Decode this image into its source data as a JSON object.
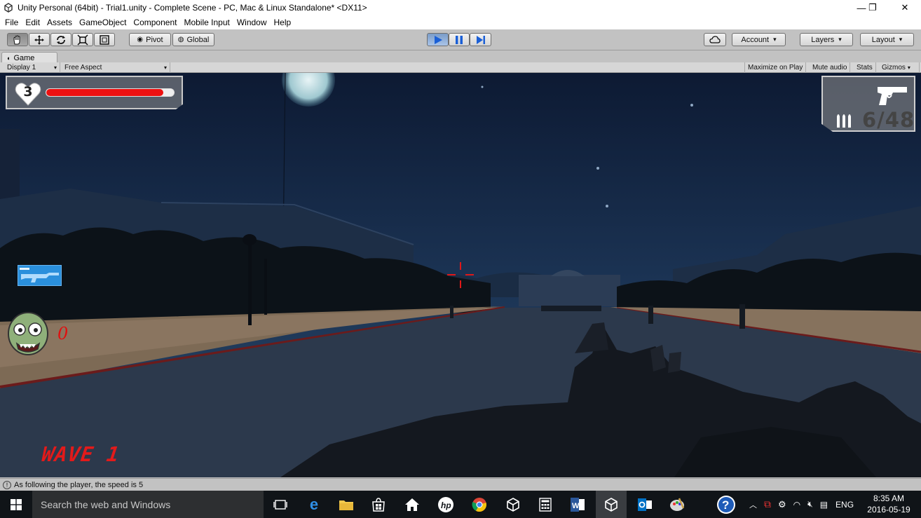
{
  "window": {
    "title": "Unity Personal (64bit) - Trial1.unity - Complete Scene - PC, Mac & Linux Standalone* <DX11>",
    "minimize": "—",
    "maximize": "❐",
    "close": "✕"
  },
  "menu": [
    "File",
    "Edit",
    "Assets",
    "GameObject",
    "Component",
    "Mobile Input",
    "Window",
    "Help"
  ],
  "toolbar": {
    "pivot_label": "Pivot",
    "global_label": "Global",
    "account_label": "Account",
    "layers_label": "Layers",
    "layout_label": "Layout",
    "play_active": true
  },
  "game_tab": {
    "label": "Game",
    "display": "Display 1",
    "aspect": "Free Aspect",
    "maximize_on_play": "Maximize on Play",
    "mute_audio": "Mute audio",
    "stats": "Stats",
    "gizmos": "Gizmos"
  },
  "hud": {
    "lives": "3",
    "health_fraction": 0.92,
    "ammo": "6/48",
    "kills": "0",
    "wave": "WAVE 1",
    "weapon_icon": "rifle-icon",
    "colors": {
      "health": "#ee1111",
      "crosshair": "#e01818",
      "wave": "#e31a1a"
    }
  },
  "status": {
    "message": "As following the player, the speed is 5"
  },
  "taskbar": {
    "search_placeholder": "Search the web and Windows",
    "language": "ENG",
    "time": "8:35 AM",
    "date": "2016-05-19"
  }
}
